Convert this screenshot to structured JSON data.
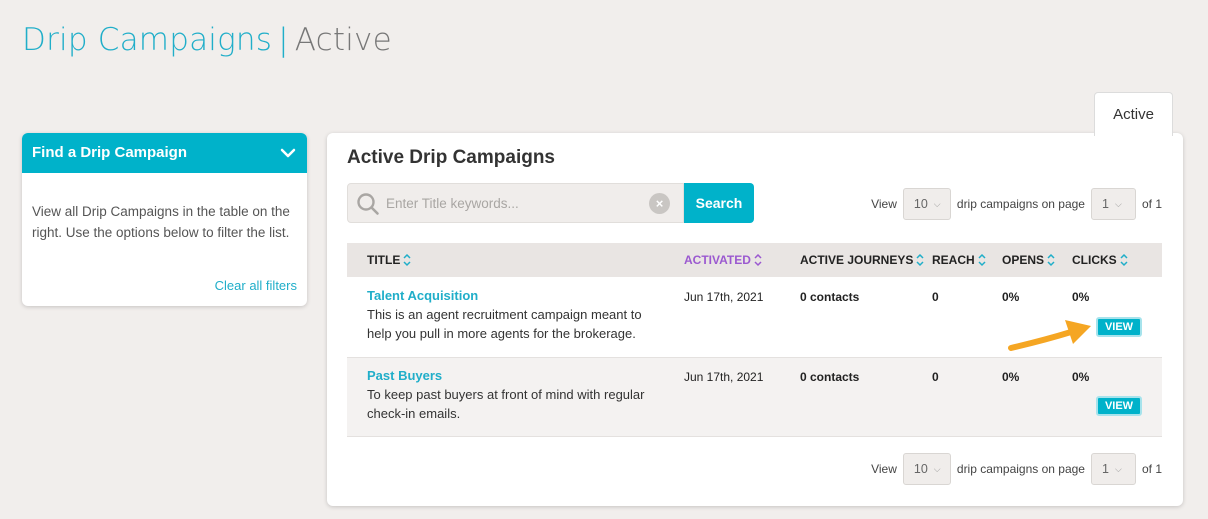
{
  "page": {
    "title_main": "Drip Campaigns",
    "title_sep": "|",
    "title_sub": "Active"
  },
  "tabs": [
    {
      "label": "Active"
    }
  ],
  "sidebar": {
    "header": "Find a Drip Campaign",
    "description": "View all Drip Campaigns in the table on the right. Use the options below to filter the list.",
    "clear_label": "Clear all filters"
  },
  "main": {
    "title": "Active Drip Campaigns",
    "search": {
      "placeholder": "Enter Title keywords...",
      "value": "",
      "button_label": "Search"
    },
    "pager": {
      "view_label": "View",
      "per_page": "10",
      "per_page_suffix": "drip campaigns on page",
      "page": "1",
      "of_label": "of 1"
    },
    "columns": {
      "title": "TITLE",
      "activated": "ACTIVATED",
      "active_journeys": "ACTIVE JOURNEYS",
      "reach": "REACH",
      "opens": "OPENS",
      "clicks": "CLICKS"
    },
    "rows": [
      {
        "name": "Talent Acquisition",
        "description": "This is an agent recruitment campaign meant to help you pull in more agents for the brokerage.",
        "activated": "Jun 17th, 2021",
        "active_journeys": "0 contacts",
        "reach": "0",
        "opens": "0%",
        "clicks": "0%",
        "action": "VIEW"
      },
      {
        "name": "Past Buyers",
        "description": "To keep past buyers at front of mind with regular check-in emails.",
        "activated": "Jun 17th, 2021",
        "active_journeys": "0 contacts",
        "reach": "0",
        "opens": "0%",
        "clicks": "0%",
        "action": "VIEW"
      }
    ]
  },
  "colors": {
    "accent": "#00b2ca",
    "link": "#20aec9",
    "sorted_column": "#9b59d0",
    "background": "#f1eeec",
    "annotation_arrow": "#f5a623"
  },
  "icons": [
    "chevron-down-icon",
    "search-icon",
    "clear-icon",
    "sort-icon",
    "dropdown-caret-icon",
    "annotation-arrow-icon"
  ]
}
